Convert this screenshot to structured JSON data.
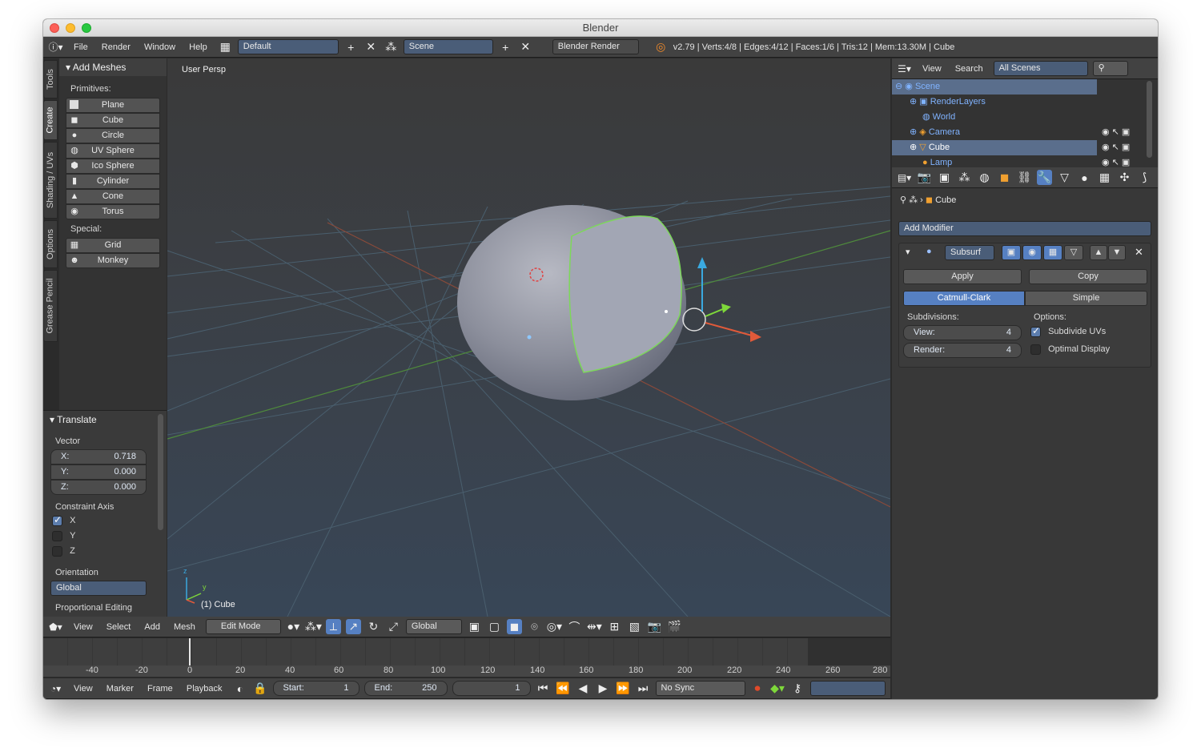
{
  "window": {
    "title": "Blender"
  },
  "topbar": {
    "menus": [
      "File",
      "Render",
      "Window",
      "Help"
    ],
    "layout": "Default",
    "scene": "Scene",
    "engine": "Blender Render",
    "stats": "v2.79 | Verts:4/8 | Edges:4/12 | Faces:1/6 | Tris:12 | Mem:13.30M | Cube"
  },
  "toolshelf": {
    "tabs": [
      "Tools",
      "Create",
      "Shading / UVs",
      "Options",
      "Grease Pencil"
    ],
    "panel_title": "Add Meshes",
    "primitives_label": "Primitives:",
    "primitives": [
      "Plane",
      "Cube",
      "Circle",
      "UV Sphere",
      "Ico Sphere",
      "Cylinder",
      "Cone",
      "Torus"
    ],
    "special_label": "Special:",
    "special": [
      "Grid",
      "Monkey"
    ]
  },
  "operator": {
    "title": "Translate",
    "vector_label": "Vector",
    "x_label": "X:",
    "x": "0.718",
    "y_label": "Y:",
    "y": "0.000",
    "z_label": "Z:",
    "z": "0.000",
    "constraint_label": "Constraint Axis",
    "axes": [
      "X",
      "Y",
      "Z"
    ],
    "axes_checked": [
      true,
      false,
      false
    ],
    "orientation_label": "Orientation",
    "orientation": "Global",
    "proportional_label": "Proportional Editing"
  },
  "viewport": {
    "view_name": "User Persp",
    "object_label": "(1) Cube",
    "axis_z": "z",
    "axis_y": "y"
  },
  "viewheader": {
    "menus": [
      "View",
      "Select",
      "Add",
      "Mesh"
    ],
    "mode": "Edit Mode",
    "orientation": "Global"
  },
  "timeline": {
    "ticks": [
      "-40",
      "-20",
      "0",
      "20",
      "40",
      "60",
      "80",
      "100",
      "120",
      "140",
      "160",
      "180",
      "200",
      "220",
      "240",
      "260",
      "280"
    ],
    "menus": [
      "View",
      "Marker",
      "Frame",
      "Playback"
    ],
    "start_label": "Start:",
    "start": "1",
    "end_label": "End:",
    "end": "250",
    "current": "1",
    "sync": "No Sync"
  },
  "outliner": {
    "menus": [
      "View",
      "Search"
    ],
    "filter": "All Scenes",
    "items": [
      "Scene",
      "RenderLayers",
      "World",
      "Camera",
      "Cube",
      "Lamp"
    ]
  },
  "properties": {
    "context_object": "Cube",
    "add_modifier": "Add Modifier",
    "modifier_name": "Subsurf",
    "apply": "Apply",
    "copy": "Copy",
    "type_a": "Catmull-Clark",
    "type_b": "Simple",
    "subdivisions_label": "Subdivisions:",
    "view_label": "View:",
    "view_value": "4",
    "render_label": "Render:",
    "render_value": "4",
    "options_label": "Options:",
    "opt1": "Subdivide UVs",
    "opt1_checked": true,
    "opt2": "Optimal Display",
    "opt2_checked": false
  },
  "colors": {
    "accent": "#5680c2",
    "selected_edge": "#7dd85a",
    "viewport_top": "#3b3b3b",
    "viewport_bottom": "#3b4a5c"
  }
}
